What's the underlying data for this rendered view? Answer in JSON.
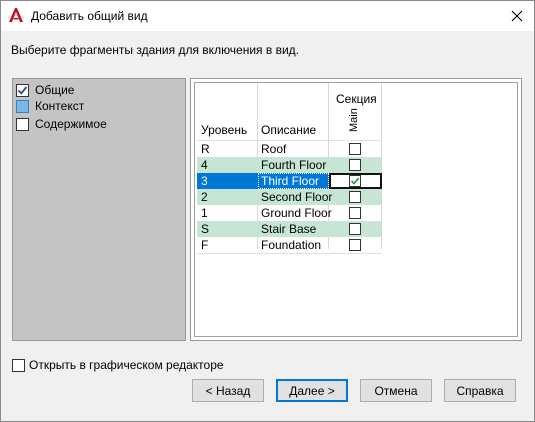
{
  "window": {
    "title": "Добавить общий вид",
    "prompt": "Выберите фрагменты здания для включения в вид."
  },
  "categories": [
    {
      "label": "Общие",
      "state": "checked"
    },
    {
      "label": "Контекст",
      "state": "filled"
    },
    {
      "label": "Содержимое",
      "state": "unchecked"
    }
  ],
  "grid": {
    "header_level": "Уровень",
    "header_desc": "Описание",
    "header_section": "Секция",
    "header_main": "Main",
    "rows": [
      {
        "level": "R",
        "desc": "Roof",
        "main": false
      },
      {
        "level": "4",
        "desc": "Fourth Floor",
        "main": false
      },
      {
        "level": "3",
        "desc": "Third Floor",
        "main": true
      },
      {
        "level": "2",
        "desc": "Second Floor",
        "main": false
      },
      {
        "level": "1",
        "desc": "Ground Floor",
        "main": false
      },
      {
        "level": "S",
        "desc": "Stair Base",
        "main": false
      },
      {
        "level": "F",
        "desc": "Foundation",
        "main": false
      }
    ]
  },
  "footer": {
    "open_editor_label": "Открыть в графическом редакторе",
    "open_editor_checked": false
  },
  "buttons": {
    "back": "< Назад",
    "next": "Далее >",
    "cancel": "Отмена",
    "help": "Справка"
  },
  "colors": {
    "selection": "#0078d7",
    "alt_row": "#c4e6d3",
    "left_panel": "#c4c4c4",
    "app_icon": "#c8102e"
  },
  "icons": {
    "app": "autocad-logo-icon",
    "close": "close-icon"
  }
}
